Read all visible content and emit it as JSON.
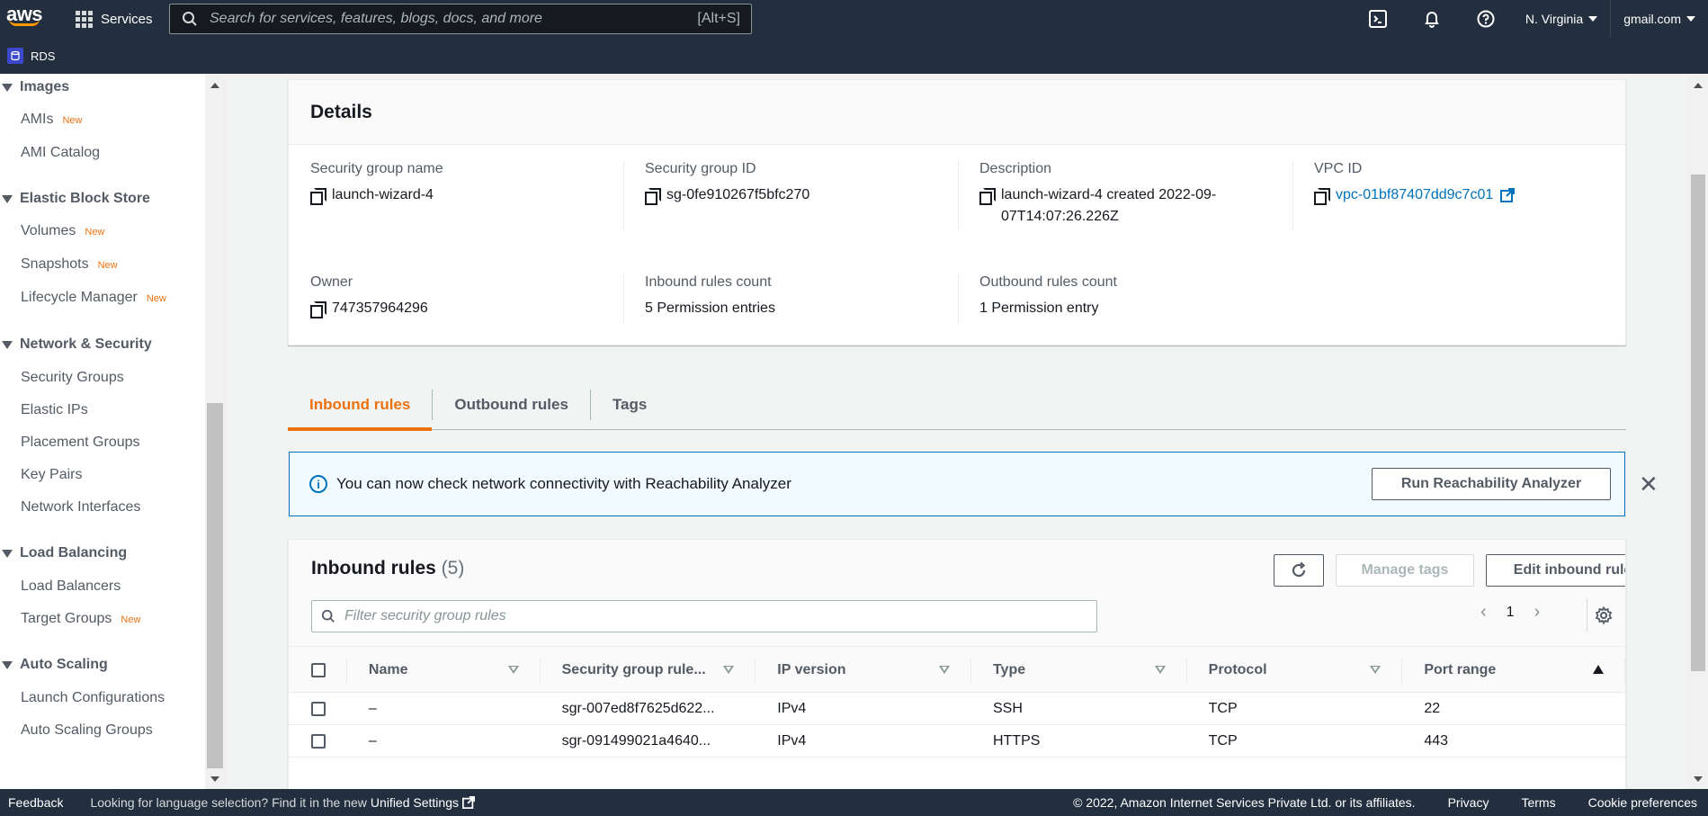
{
  "topnav": {
    "logo_text": "aws",
    "services_label": "Services",
    "search_placeholder": "Search for services, features, blogs, docs, and more",
    "search_shortcut": "[Alt+S]",
    "region": "N. Virginia",
    "account": "gmail.com"
  },
  "subnav": {
    "service": "RDS"
  },
  "sidebar": {
    "new_badge": "New",
    "sections": [
      {
        "title": "Images",
        "items": [
          {
            "label": "AMIs",
            "new": true
          },
          {
            "label": "AMI Catalog",
            "new": false
          }
        ]
      },
      {
        "title": "Elastic Block Store",
        "items": [
          {
            "label": "Volumes",
            "new": true
          },
          {
            "label": "Snapshots",
            "new": true
          },
          {
            "label": "Lifecycle Manager",
            "new": true
          }
        ]
      },
      {
        "title": "Network & Security",
        "items": [
          {
            "label": "Security Groups"
          },
          {
            "label": "Elastic IPs"
          },
          {
            "label": "Placement Groups"
          },
          {
            "label": "Key Pairs"
          },
          {
            "label": "Network Interfaces"
          }
        ]
      },
      {
        "title": "Load Balancing",
        "items": [
          {
            "label": "Load Balancers"
          },
          {
            "label": "Target Groups",
            "new": true
          }
        ]
      },
      {
        "title": "Auto Scaling",
        "items": [
          {
            "label": "Launch Configurations"
          },
          {
            "label": "Auto Scaling Groups"
          }
        ]
      }
    ]
  },
  "details": {
    "title": "Details",
    "fields": [
      {
        "key": "Security group name",
        "value": "launch-wizard-4"
      },
      {
        "key": "Security group ID",
        "value": "sg-0fe910267f5bfc270"
      },
      {
        "key": "Description",
        "value": "launch-wizard-4 created 2022-09-07T14:07:26.226Z"
      },
      {
        "key": "VPC ID",
        "value": "vpc-01bf87407dd9c7c01"
      },
      {
        "key": "Owner",
        "value": "747357964296"
      },
      {
        "key": "Inbound rules count",
        "value": "5 Permission entries"
      },
      {
        "key": "Outbound rules count",
        "value": "1 Permission entry"
      }
    ]
  },
  "tabs": [
    "Inbound rules",
    "Outbound rules",
    "Tags"
  ],
  "alert": {
    "text": "You can now check network connectivity with Reachability Analyzer",
    "button": "Run Reachability Analyzer"
  },
  "inbound": {
    "title": "Inbound rules",
    "count": "(5)",
    "manage_tags": "Manage tags",
    "edit_rules": "Edit inbound rules",
    "filter_placeholder": "Filter security group rules",
    "page": "1",
    "columns": [
      "Name",
      "Security group rule...",
      "IP version",
      "Type",
      "Protocol",
      "Port range"
    ],
    "rows": [
      [
        "–",
        "sgr-007ed8f7625d622...",
        "IPv4",
        "SSH",
        "TCP",
        "22"
      ],
      [
        "–",
        "sgr-091499021a4640...",
        "IPv4",
        "HTTPS",
        "TCP",
        "443"
      ]
    ]
  },
  "footer": {
    "feedback": "Feedback",
    "lang_text": "Looking for language selection? Find it in the new",
    "unified": "Unified Settings",
    "copyright": "© 2022, Amazon Internet Services Private Ltd. or its affiliates.",
    "privacy": "Privacy",
    "terms": "Terms",
    "cookies": "Cookie preferences"
  },
  "colors": {
    "nav_bg": "#232f3e",
    "accent_orange": "#ec7211",
    "link_blue": "#0073bb",
    "alert_bg": "#f1faff"
  }
}
